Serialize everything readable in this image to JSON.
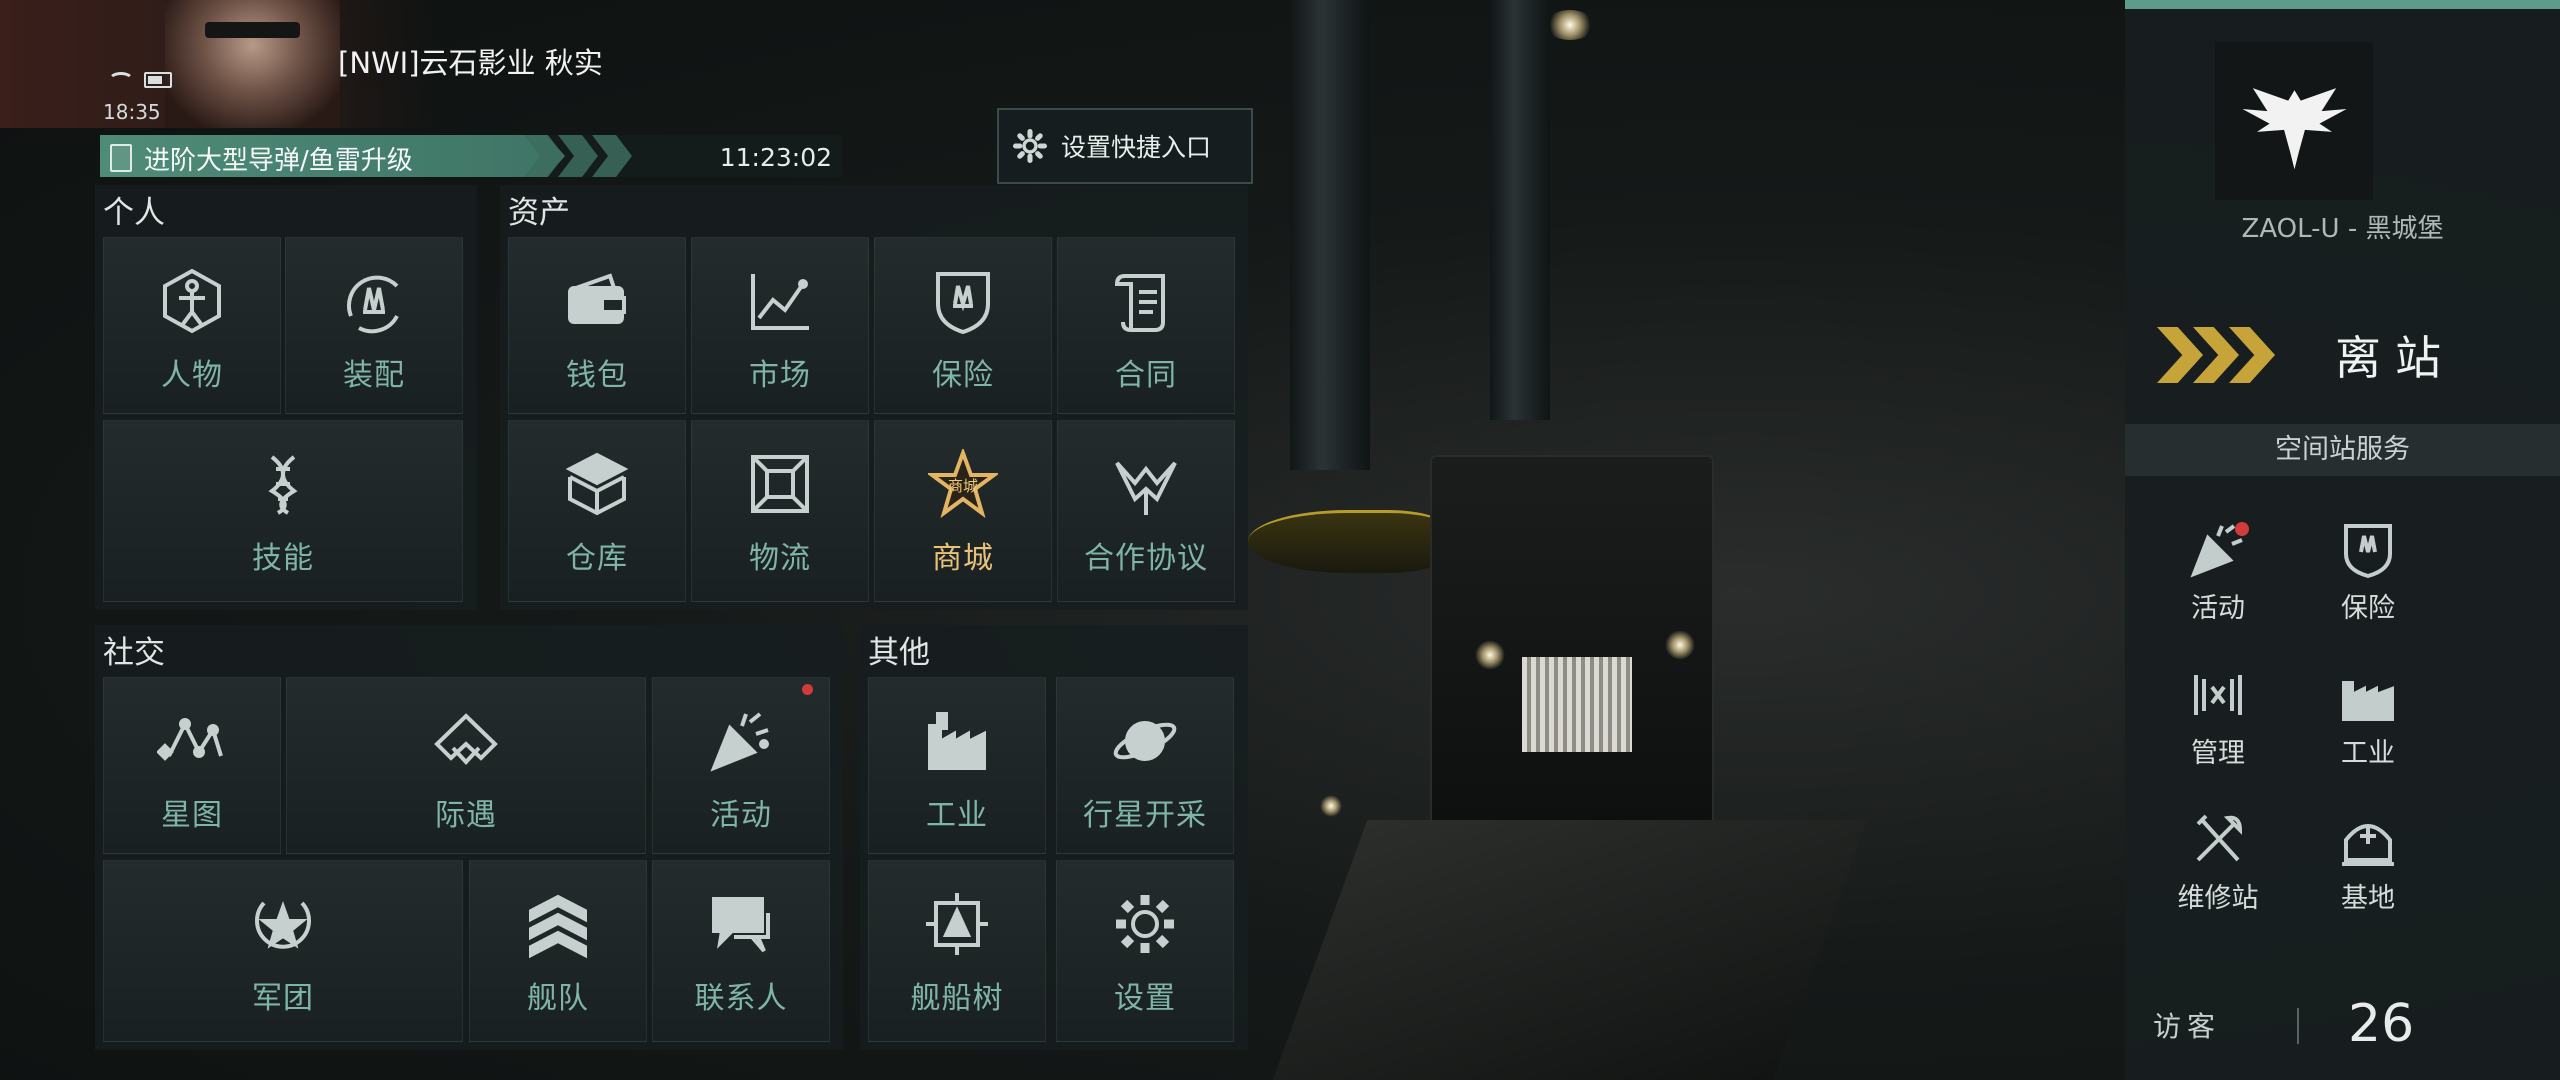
{
  "player": {
    "name": "[NWI]云石影业 秋实",
    "clock": "18:35"
  },
  "quest": {
    "title": "进阶大型导弹/鱼雷升级",
    "timer": "11:23:02"
  },
  "shortcut": {
    "label": "设置快捷入口"
  },
  "sections": {
    "personal": {
      "title": "个人",
      "items": [
        "人物",
        "装配",
        "技能"
      ]
    },
    "assets": {
      "title": "资产",
      "items": [
        "钱包",
        "市场",
        "保险",
        "合同",
        "仓库",
        "物流",
        "商城",
        "合作协议"
      ]
    },
    "social": {
      "title": "社交",
      "items": [
        "星图",
        "际遇",
        "活动",
        "军团",
        "舰队",
        "联系人"
      ]
    },
    "other": {
      "title": "其他",
      "items": [
        "工业",
        "行星开采",
        "舰船树",
        "设置"
      ]
    }
  },
  "store_badge": "商城",
  "sidebar": {
    "station": "ZAOL-U - 黑城堡",
    "undock": "离站",
    "services_title": "空间站服务",
    "services": [
      "活动",
      "保险",
      "管理",
      "工业",
      "维修站",
      "基地"
    ],
    "visitor_label": "访客",
    "visitor_count": "26"
  },
  "colors": {
    "accent": "#5d9b8a",
    "label_teal": "#7fb5a6",
    "gold": "#c7a43a",
    "badge_red": "#d03b3b"
  }
}
